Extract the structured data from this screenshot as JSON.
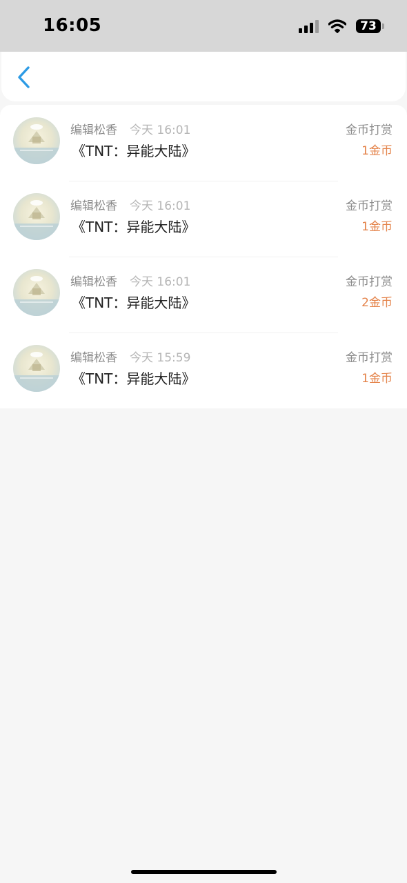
{
  "status_bar": {
    "time": "16:05",
    "battery": "73",
    "icons": [
      "cellular-signal-icon",
      "wifi-icon",
      "battery-icon"
    ]
  },
  "nav": {
    "back_icon": "chevron-left-icon",
    "accent_color": "#2d9be5"
  },
  "rewards": [
    {
      "author": "编辑松香",
      "time": "今天 16:01",
      "book": "《TNT：异能大陆》",
      "type": "金币打赏",
      "amount": "1金币"
    },
    {
      "author": "编辑松香",
      "time": "今天 16:01",
      "book": "《TNT：异能大陆》",
      "type": "金币打赏",
      "amount": "1金币"
    },
    {
      "author": "编辑松香",
      "time": "今天 16:01",
      "book": "《TNT：异能大陆》",
      "type": "金币打赏",
      "amount": "2金币"
    },
    {
      "author": "编辑松香",
      "time": "今天 15:59",
      "book": "《TNT：异能大陆》",
      "type": "金币打赏",
      "amount": "1金币"
    }
  ],
  "colors": {
    "amount": "#e4834a",
    "secondary_text": "#8b8b8b",
    "background": "#f6f6f6"
  }
}
